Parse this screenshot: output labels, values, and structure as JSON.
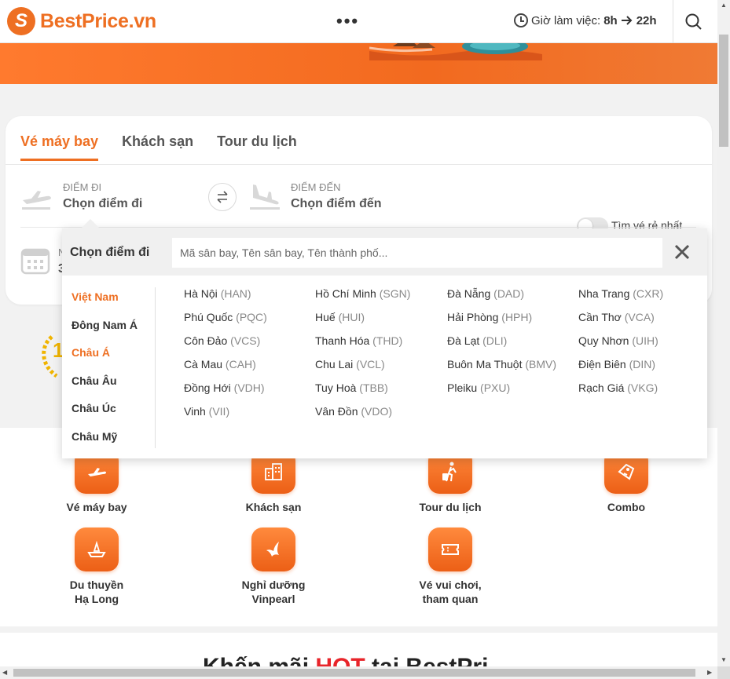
{
  "header": {
    "brand": "BestPrice.vn",
    "more": "•••",
    "work_hours_label": "Giờ làm việc:",
    "hours_start": "8h",
    "hours_end": "22h"
  },
  "search": {
    "tabs": [
      {
        "label": "Vé máy bay",
        "active": true
      },
      {
        "label": "Khách sạn",
        "active": false
      },
      {
        "label": "Tour du lịch",
        "active": false
      }
    ],
    "from_label": "ĐIỂM ĐI",
    "from_value": "Chọn điểm đi",
    "to_label": "ĐIỂM ĐẾN",
    "to_value": "Chọn điểm đến",
    "date_label_partial": "N",
    "date_value_partial": "3",
    "cheapest_toggle_label": "Tìm vé rẻ nhất"
  },
  "dropdown": {
    "title": "Chọn điểm đi",
    "placeholder": "Mã sân bay, Tên sân bay, Tên thành phố...",
    "regions": [
      "Việt Nam",
      "Đông Nam Á",
      "Châu Á",
      "Châu Âu",
      "Châu Úc",
      "Châu Mỹ"
    ],
    "active_region": "Việt Nam",
    "cities": [
      {
        "name": "Hà Nội",
        "code": "(HAN)"
      },
      {
        "name": "Hồ Chí Minh",
        "code": "(SGN)"
      },
      {
        "name": "Đà Nẵng",
        "code": "(DAD)"
      },
      {
        "name": "Nha Trang",
        "code": "(CXR)"
      },
      {
        "name": "Phú Quốc",
        "code": "(PQC)"
      },
      {
        "name": "Huế",
        "code": "(HUI)"
      },
      {
        "name": "Hải Phòng",
        "code": "(HPH)"
      },
      {
        "name": "Cần Thơ",
        "code": "(VCA)"
      },
      {
        "name": "Côn Đảo",
        "code": "(VCS)"
      },
      {
        "name": "Thanh Hóa",
        "code": "(THD)"
      },
      {
        "name": "Đà Lạt",
        "code": "(DLI)"
      },
      {
        "name": "Quy Nhơn",
        "code": "(UIH)"
      },
      {
        "name": "Cà Mau",
        "code": "(CAH)"
      },
      {
        "name": "Chu Lai",
        "code": "(VCL)"
      },
      {
        "name": "Buôn Ma Thuột",
        "code": "(BMV)"
      },
      {
        "name": "Điện Biên",
        "code": "(DIN)"
      },
      {
        "name": "Đồng Hới",
        "code": "(VDH)"
      },
      {
        "name": "Tuy Hoà",
        "code": "(TBB)"
      },
      {
        "name": "Pleiku",
        "code": "(PXU)"
      },
      {
        "name": "Rạch Giá",
        "code": "(VKG)"
      },
      {
        "name": "Vinh",
        "code": "(VII)"
      },
      {
        "name": "Vân Đồn",
        "code": "(VDO)"
      }
    ]
  },
  "services": [
    {
      "label": "Vé máy bay",
      "icon": "plane-icon"
    },
    {
      "label": "Khách sạn",
      "icon": "hotel-icon"
    },
    {
      "label": "Tour du lịch",
      "icon": "traveler-icon"
    },
    {
      "label": "Combo",
      "icon": "ticket-tag-icon"
    },
    {
      "label": "Du thuyền\nHạ Long",
      "icon": "boat-icon"
    },
    {
      "label": "Nghỉ dưỡng\nVinpearl",
      "icon": "vinpearl-icon"
    },
    {
      "label": "Vé vui chơi,\ntham quan",
      "icon": "ticket-icon"
    }
  ],
  "hot_section": {
    "title_start": "Kh",
    "title_mid": "ến m",
    "title_hot_prefix": "ãi ",
    "hot_word": "HOT",
    "title_end": " tại BestPri"
  },
  "colors": {
    "accent": "#ee6f22",
    "hot": "#e8242a"
  }
}
